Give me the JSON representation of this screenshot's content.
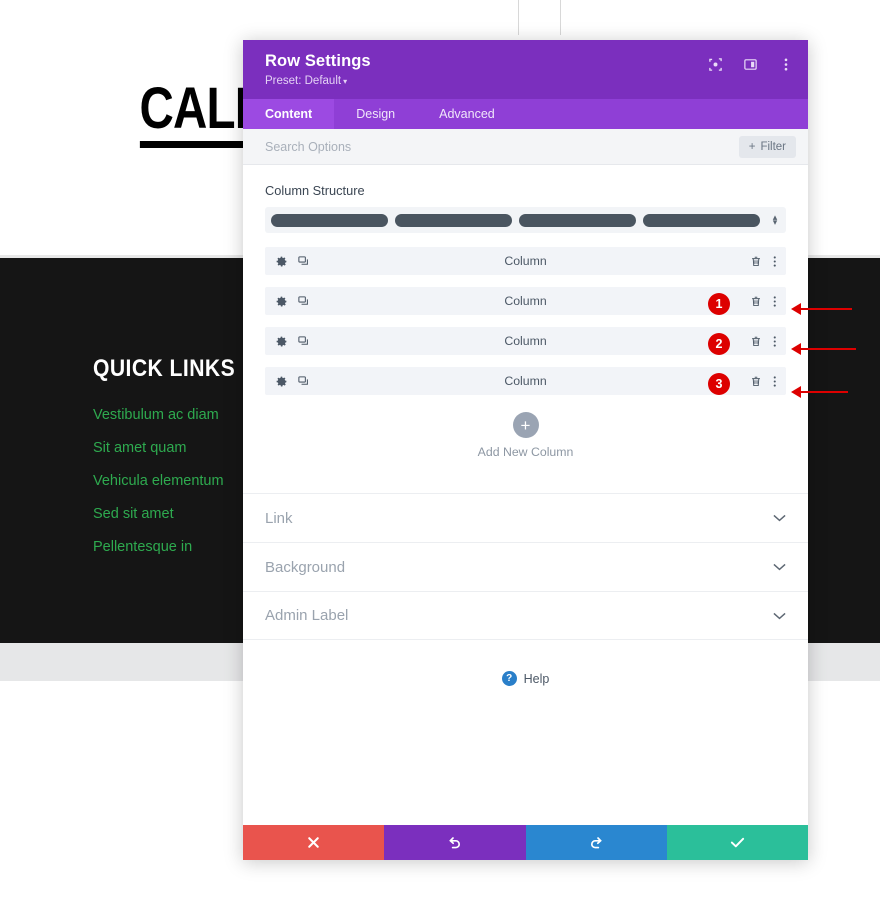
{
  "background": {
    "heading": "CALL US AND FOLLOW US",
    "footer": {
      "title": "QUICK LINKS",
      "links": [
        "Vestibulum ac diam",
        "Sit amet quam",
        "Vehicula elementum",
        "Sed sit amet",
        "Pellentesque in"
      ]
    },
    "colors": {
      "link_green": "#2eaa4f",
      "footer_dark": "#151515",
      "band_gray": "#e6e7e8"
    }
  },
  "modal": {
    "title": "Row Settings",
    "preset_label": "Preset: Default",
    "preset_caret": "▾",
    "header_icons": [
      {
        "name": "focus-target-icon"
      },
      {
        "name": "panel-layout-icon"
      },
      {
        "name": "kebab-menu-icon"
      }
    ],
    "tabs": [
      {
        "label": "Content",
        "active": true
      },
      {
        "label": "Design",
        "active": false
      },
      {
        "label": "Advanced",
        "active": false
      }
    ],
    "search": {
      "placeholder": "Search Options",
      "value": "",
      "filter_label": "Filter",
      "filter_plus": "+"
    },
    "column_structure": {
      "label": "Column Structure",
      "segments": 4,
      "stepper_up": "▴",
      "stepper_down": "▾"
    },
    "columns": [
      {
        "label": "Column",
        "badge": null
      },
      {
        "label": "Column",
        "badge": "1"
      },
      {
        "label": "Column",
        "badge": "2"
      },
      {
        "label": "Column",
        "badge": "3"
      }
    ],
    "add_column": {
      "plus": "+",
      "label": "Add New Column"
    },
    "toggle_sections": [
      {
        "label": "Link"
      },
      {
        "label": "Background"
      },
      {
        "label": "Admin Label"
      }
    ],
    "help": {
      "icon_glyph": "?",
      "label": "Help"
    },
    "actions": [
      {
        "name": "cancel-button",
        "glyph": "✖",
        "color": "#e9544d"
      },
      {
        "name": "undo-button",
        "glyph": "↺",
        "color": "#7b2fbe"
      },
      {
        "name": "redo-button",
        "glyph": "↻",
        "color": "#2a87d0"
      },
      {
        "name": "save-button",
        "glyph": "✔",
        "color": "#2bbf9a"
      }
    ],
    "colors": {
      "header_purple": "#7b2fbe",
      "tabbar_purple": "#8f3fd6",
      "active_tab_purple": "#9c4ae2",
      "badge_red": "#dd0000"
    }
  },
  "annotations": {
    "arrow_color": "#dd0000",
    "arrows": [
      {
        "number": "1"
      },
      {
        "number": "2"
      },
      {
        "number": "3"
      }
    ]
  }
}
